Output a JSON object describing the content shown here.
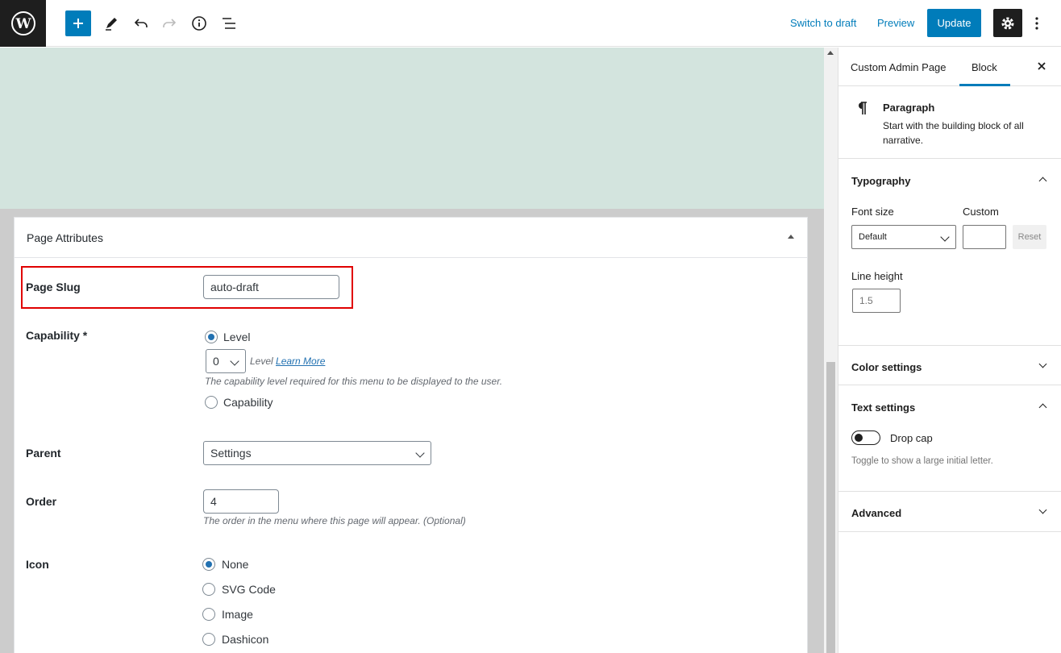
{
  "toolbar": {
    "add_label": "+",
    "switch_to_draft": "Switch to draft",
    "preview": "Preview",
    "update": "Update"
  },
  "page_attributes": {
    "title": "Page Attributes",
    "page_slug": {
      "label": "Page Slug",
      "value": "auto-draft"
    },
    "capability": {
      "label": "Capability *",
      "option_level": "Level",
      "level_value": "0",
      "level_help_prefix": "Level",
      "level_help_link": "Learn More",
      "level_description": "The capability level required for this menu to be displayed to the user.",
      "option_capability": "Capability"
    },
    "parent": {
      "label": "Parent",
      "value": "Settings"
    },
    "order": {
      "label": "Order",
      "value": "4",
      "help": "The order in the menu where this page will appear. (Optional)"
    },
    "icon": {
      "label": "Icon",
      "options": [
        "None",
        "SVG Code",
        "Image",
        "Dashicon"
      ],
      "selected": "None"
    }
  },
  "sidebar": {
    "tabs": [
      "Custom Admin Page",
      "Block"
    ],
    "active_tab": "Block",
    "block": {
      "name": "Paragraph",
      "description": "Start with the building block of all narrative."
    },
    "typography": {
      "title": "Typography",
      "font_size_label": "Font size",
      "custom_label": "Custom",
      "font_size_value": "Default",
      "reset": "Reset",
      "line_height_label": "Line height",
      "line_height_placeholder": "1.5"
    },
    "color_settings": "Color settings",
    "text_settings": {
      "title": "Text settings",
      "drop_cap_label": "Drop cap",
      "drop_cap_help": "Toggle to show a large initial letter."
    },
    "advanced": "Advanced"
  },
  "colors": {
    "accent": "#007cba",
    "highlight_border": "#e00000",
    "canvas_bg": "#d3e4de"
  }
}
